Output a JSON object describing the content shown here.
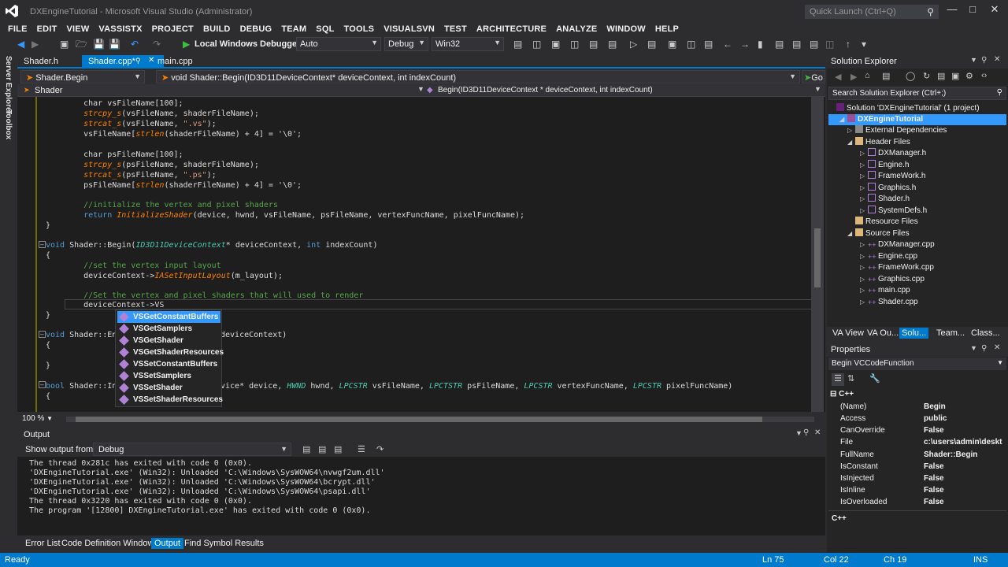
{
  "app": {
    "title": "DXEngineTutorial - Microsoft Visual Studio (Administrator)",
    "quick_launch": "Quick Launch (Ctrl+Q)"
  },
  "menu": [
    "FILE",
    "EDIT",
    "VIEW",
    "VASSISTX",
    "PROJECT",
    "BUILD",
    "DEBUG",
    "TEAM",
    "SQL",
    "TOOLS",
    "VISUALSVN",
    "TEST",
    "ARCHITECTURE",
    "ANALYZE",
    "WINDOW",
    "HELP"
  ],
  "toolbar": {
    "debugger_label": "Local Windows Debugger",
    "config_auto": "Auto",
    "config_debug": "Debug",
    "platform": "Win32"
  },
  "left_rail": {
    "server_explorer": "Server Explorer",
    "toolbox": "Toolbox"
  },
  "doc_tabs": [
    {
      "label": "Shader.h",
      "active": false
    },
    {
      "label": "Shader.cpp*",
      "active": true
    },
    {
      "label": "main.cpp",
      "active": false
    }
  ],
  "nav": {
    "scope": "Shader.Begin",
    "member": "void Shader::Begin(ID3D11DeviceContext* deviceContext, int indexCount)",
    "go": "Go",
    "class_scope": "Shader",
    "function_scope": "Begin(ID3D11DeviceContext * deviceContext, int indexCount)"
  },
  "code": {
    "l1": "char vsFileName[100];",
    "l2a": "strcpy_s",
    "l2b": "(vsFileName, shaderFileName);",
    "l3a": "strcat_s",
    "l3b": "(vsFileName, ",
    "l3c": "\".vs\"",
    "l3d": ");",
    "l4a": "vsFileName[",
    "l4b": "strlen",
    "l4c": "(shaderFileName) + 4] = '\\0';",
    "l5": "char psFileName[100];",
    "l6a": "strcpy_s",
    "l6b": "(psFileName, shaderFileName);",
    "l7a": "strcat_s",
    "l7b": "(psFileName, ",
    "l7c": "\".ps\"",
    "l7d": ");",
    "l8a": "psFileName[",
    "l8b": "strlen",
    "l8c": "(shaderFileName) + 4] = '\\0';",
    "l9": "//initialize the vertex and pixel shaders",
    "l10a": "return ",
    "l10b": "InitializeShader",
    "l10c": "(device, hwnd, vsFileName, psFileName, vertexFuncName, pixelFuncName);",
    "l11": "}",
    "l12a": "void ",
    "l12b": "Shader::Begin(",
    "l12c": "ID3D11DeviceContext",
    "l12d": "* deviceContext, ",
    "l12e": "int",
    "l12f": " indexCount)",
    "l13": "{",
    "l14": "//set the vertex input layout",
    "l15a": "deviceContext->",
    "l15b": "IASetInputLayout",
    "l15c": "(m_layout);",
    "l16": "//Set the vertex and pixel shaders that will used to render",
    "l17": "deviceContext->VS",
    "l18": "}",
    "l19a": "void ",
    "l19b": "Shader::En",
    "l19c": "deviceContext)",
    "l20": "{",
    "l21": "}",
    "l22a": "bool ",
    "l22b": "Shader::In",
    "l22c": "vice* device, ",
    "l22d": "HWND",
    "l22e": " hwnd, ",
    "l22f": "LPCSTR",
    "l22g": " vsFileName, ",
    "l22h": "LPCTSTR",
    "l22i": " psFileName, ",
    "l22j": "LPCSTR",
    "l22k": " vertexFuncName, ",
    "l22l": "LPCSTR",
    "l22m": " pixelFuncName)",
    "l23": "{"
  },
  "intellisense": [
    "VSGetConstantBuffers",
    "VSGetSamplers",
    "VSGetShader",
    "VSGetShaderResources",
    "VSSetConstantBuffers",
    "VSSetSamplers",
    "VSSetShader",
    "VSSetShaderResources"
  ],
  "zoom": "100 %",
  "output": {
    "title": "Output",
    "show_from_label": "Show output from:",
    "show_from_value": "Debug",
    "lines": [
      "The thread 0x281c has exited with code 0 (0x0).",
      "'DXEngineTutorial.exe' (Win32): Unloaded 'C:\\Windows\\SysWOW64\\nvwgf2um.dll'",
      "'DXEngineTutorial.exe' (Win32): Unloaded 'C:\\Windows\\SysWOW64\\bcrypt.dll'",
      "'DXEngineTutorial.exe' (Win32): Unloaded 'C:\\Windows\\SysWOW64\\psapi.dll'",
      "The thread 0x3220 has exited with code 0 (0x0).",
      "The program '[12800] DXEngineTutorial.exe' has exited with code 0 (0x0)."
    ]
  },
  "bottom_tabs": [
    "Error List",
    "Code Definition Window",
    "Output",
    "Find Symbol Results"
  ],
  "status": {
    "ready": "Ready",
    "ln": "Ln 75",
    "col": "Col 22",
    "ch": "Ch 19",
    "ins": "INS"
  },
  "solution_explorer": {
    "title": "Solution Explorer",
    "search": "Search Solution Explorer (Ctrl+;)",
    "solution": "Solution 'DXEngineTutorial' (1 project)",
    "project": "DXEngineTutorial",
    "external": "External Dependencies",
    "header_files": "Header Files",
    "headers": [
      "DXManager.h",
      "Engine.h",
      "FrameWork.h",
      "Graphics.h",
      "Shader.h",
      "SystemDefs.h"
    ],
    "resource_files": "Resource Files",
    "source_files": "Source Files",
    "sources": [
      "DXManager.cpp",
      "Engine.cpp",
      "FrameWork.cpp",
      "Graphics.cpp",
      "main.cpp",
      "Shader.cpp"
    ]
  },
  "panel_tabs": [
    "VA View",
    "VA Ou...",
    "Solu...",
    "Team...",
    "Class..."
  ],
  "properties": {
    "title": "Properties",
    "object": "Begin  VCCodeFunction",
    "category": "C++",
    "rows": [
      {
        "k": "(Name)",
        "v": "Begin"
      },
      {
        "k": "Access",
        "v": "public"
      },
      {
        "k": "CanOverride",
        "v": "False"
      },
      {
        "k": "File",
        "v": "c:\\users\\admin\\deskt"
      },
      {
        "k": "FullName",
        "v": "Shader::Begin"
      },
      {
        "k": "IsConstant",
        "v": "False"
      },
      {
        "k": "IsInjected",
        "v": "False"
      },
      {
        "k": "IsInline",
        "v": "False"
      },
      {
        "k": "IsOverloaded",
        "v": "False"
      }
    ],
    "footer": "C++"
  }
}
